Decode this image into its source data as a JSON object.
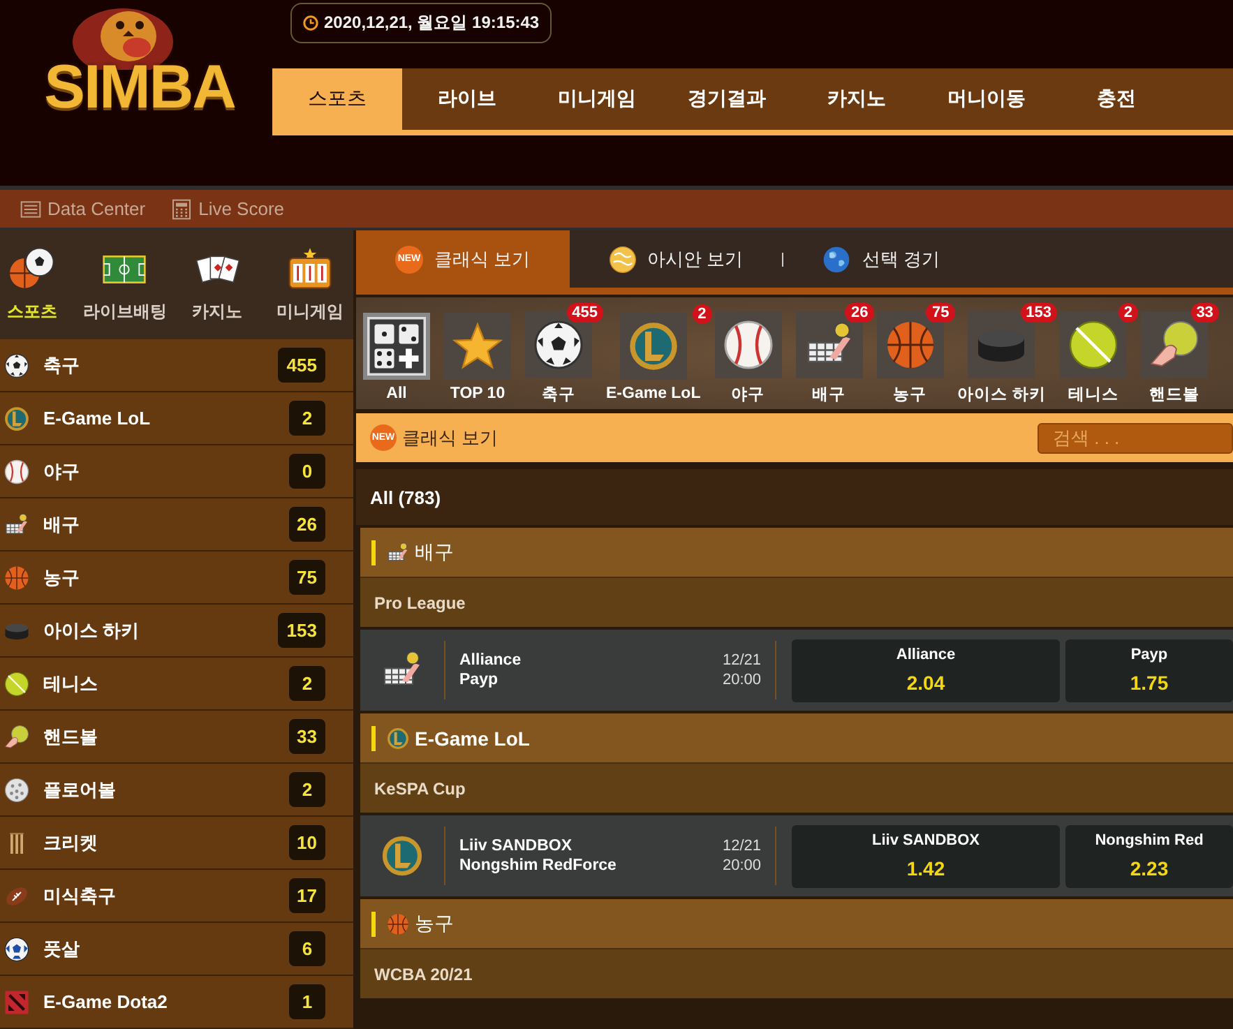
{
  "logo": {
    "text": "SIMBA"
  },
  "clock": "2020,12,21, 월요일 19:15:43",
  "nav": [
    {
      "label": "스포츠",
      "selected": true
    },
    {
      "label": "라이브",
      "selected": false
    },
    {
      "label": "미니게임",
      "selected": false
    },
    {
      "label": "경기결과",
      "selected": false
    },
    {
      "label": "카지노",
      "selected": false
    },
    {
      "label": "머니이동",
      "selected": false
    },
    {
      "label": "충전",
      "selected": false
    }
  ],
  "toolbar": [
    {
      "label": "Data Center",
      "kind": "list"
    },
    {
      "label": "Live Score",
      "kind": "calculator"
    }
  ],
  "sidebar": {
    "menu": [
      {
        "label": "스포츠",
        "kind": "sports",
        "selected": true
      },
      {
        "label": "라이브배팅",
        "kind": "field",
        "selected": false
      },
      {
        "label": "카지노",
        "kind": "cards",
        "selected": false
      },
      {
        "label": "미니게임",
        "kind": "slot",
        "selected": false
      }
    ],
    "items": [
      {
        "label": "축구",
        "kind": "soccer",
        "count": "455"
      },
      {
        "label": "E-Game LoL",
        "kind": "lol",
        "count": "2"
      },
      {
        "label": "야구",
        "kind": "baseball",
        "count": "0"
      },
      {
        "label": "배구",
        "kind": "volleyball",
        "count": "26"
      },
      {
        "label": "농구",
        "kind": "basketball",
        "count": "75"
      },
      {
        "label": "아이스 하키",
        "kind": "hockey",
        "count": "153"
      },
      {
        "label": "테니스",
        "kind": "tennis",
        "count": "2"
      },
      {
        "label": "핸드볼",
        "kind": "handball",
        "count": "33"
      },
      {
        "label": "플로어볼",
        "kind": "floorball",
        "count": "2"
      },
      {
        "label": "크리켓",
        "kind": "cricket",
        "count": "10"
      },
      {
        "label": "미식축구",
        "kind": "football",
        "count": "17"
      },
      {
        "label": "풋살",
        "kind": "futsal",
        "count": "6"
      },
      {
        "label": "E-Game Dota2",
        "kind": "dota",
        "count": "1"
      }
    ]
  },
  "view_tabs": [
    {
      "label": "클래식 보기",
      "kind": "badge",
      "badge": "NEW",
      "selected": true
    },
    {
      "label": "아시안 보기",
      "kind": "gold-globe",
      "selected": false
    },
    {
      "label": "선택 경기",
      "kind": "earth",
      "selected": false
    }
  ],
  "sport_filter": [
    {
      "label": "All",
      "kind": "all",
      "selected": true
    },
    {
      "label": "TOP 10",
      "kind": "star",
      "selected": false
    },
    {
      "label": "축구",
      "kind": "soccer",
      "count": "455",
      "selected": false
    },
    {
      "label": "E-Game LoL",
      "kind": "lol",
      "count": "2",
      "selected": false
    },
    {
      "label": "야구",
      "kind": "baseball",
      "selected": false
    },
    {
      "label": "배구",
      "kind": "volleyball",
      "count": "26",
      "selected": false
    },
    {
      "label": "농구",
      "kind": "basketball",
      "count": "75",
      "selected": false
    },
    {
      "label": "아이스 하키",
      "kind": "hockey",
      "count": "153",
      "selected": false
    },
    {
      "label": "테니스",
      "kind": "tennis",
      "count": "2",
      "selected": false
    },
    {
      "label": "핸드볼",
      "kind": "handball",
      "count": "33",
      "selected": false
    }
  ],
  "classic_bar": {
    "badge": "NEW",
    "title": "클래식 보기",
    "search": {
      "placeholder": "검색 . . ."
    }
  },
  "total": "All (783)",
  "sections": [
    {
      "kind": "volleyball",
      "title": "배구",
      "league": "Pro League",
      "matches": [
        {
          "home": "Alliance",
          "away": "Payp",
          "date": "12/21",
          "time": "20:00",
          "odds": [
            {
              "team": "Alliance",
              "price": "2.04"
            },
            {
              "team": "Payp",
              "price": "1.75"
            }
          ]
        }
      ]
    },
    {
      "kind": "lol",
      "title": "E-Game LoL",
      "league": "KeSPA Cup",
      "matches": [
        {
          "home": "Liiv SANDBOX",
          "away": "Nongshim RedForce",
          "date": "12/21",
          "time": "20:00",
          "odds": [
            {
              "team": "Liiv SANDBOX",
              "price": "1.42"
            },
            {
              "team": "Nongshim Red",
              "price": "2.23"
            }
          ]
        }
      ]
    },
    {
      "kind": "basketball",
      "title": "농구",
      "league": "WCBA 20/21"
    }
  ]
}
